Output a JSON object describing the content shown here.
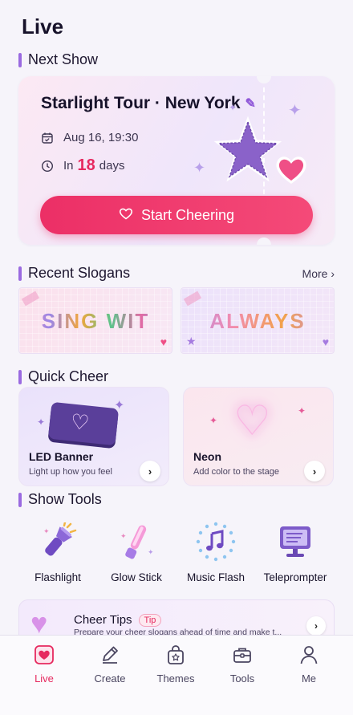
{
  "header": {
    "title": "Live"
  },
  "next_show": {
    "section_title": "Next Show",
    "show_title": "Starlight Tour · New York",
    "datetime": "Aug 16, 19:30",
    "countdown_prefix": "In",
    "countdown_value": "18",
    "countdown_suffix": "days",
    "cta_label": "Start Cheering"
  },
  "recent_slogans": {
    "section_title": "Recent Slogans",
    "more_label": "More ›",
    "items": [
      {
        "text": "SING WIT"
      },
      {
        "text": "ALWAYS"
      }
    ]
  },
  "quick_cheer": {
    "section_title": "Quick Cheer",
    "items": [
      {
        "title": "LED Banner",
        "subtitle": "Light up how you feel"
      },
      {
        "title": "Neon",
        "subtitle": "Add color to the stage"
      }
    ]
  },
  "show_tools": {
    "section_title": "Show Tools",
    "items": [
      {
        "label": "Flashlight",
        "icon": "flashlight-icon"
      },
      {
        "label": "Glow Stick",
        "icon": "glow-stick-icon"
      },
      {
        "label": "Music Flash",
        "icon": "music-flash-icon"
      },
      {
        "label": "Teleprompter",
        "icon": "teleprompter-icon"
      }
    ]
  },
  "cheer_tips": {
    "title": "Cheer Tips",
    "badge": "Tip",
    "description": "Prepare your cheer slogans ahead of time and make t..."
  },
  "tabbar": {
    "active": "Live",
    "items": [
      {
        "label": "Live",
        "icon": "live-heart-icon"
      },
      {
        "label": "Create",
        "icon": "pencil-icon"
      },
      {
        "label": "Themes",
        "icon": "bag-star-icon"
      },
      {
        "label": "Tools",
        "icon": "toolbox-icon"
      },
      {
        "label": "Me",
        "icon": "person-icon"
      }
    ]
  },
  "colors": {
    "accent": "#e6295f",
    "section_bar": "#9a6ae0",
    "cta": "#ec2f66"
  }
}
